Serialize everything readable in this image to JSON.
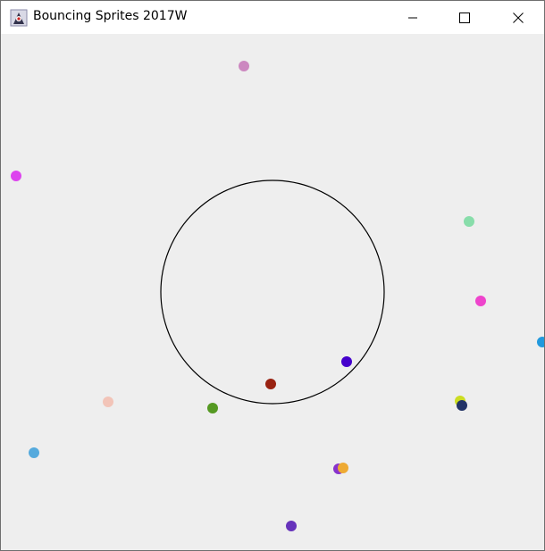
{
  "window": {
    "title": "Bouncing Sprites 2017W",
    "app_icon": "java-duke-icon",
    "controls": {
      "minimize_icon": "minimize-icon",
      "maximize_icon": "maximize-icon",
      "close_icon": "close-icon"
    }
  },
  "canvas": {
    "background": "#eeeeee",
    "boundary_circle": {
      "stroke": "#000000"
    },
    "sprites": [
      {
        "color": "#cc88c0"
      },
      {
        "color": "#dd44ee"
      },
      {
        "color": "#88ddaa"
      },
      {
        "color": "#ee44cc"
      },
      {
        "color": "#2299dd"
      },
      {
        "color": "#4400cc"
      },
      {
        "color": "#992211"
      },
      {
        "color": "#559922"
      },
      {
        "color": "#f2c4b8"
      },
      {
        "color": "#ccdd22"
      },
      {
        "color": "#223366"
      },
      {
        "color": "#55aadd"
      },
      {
        "color": "#8833cc"
      },
      {
        "color": "#eeaa33"
      },
      {
        "color": "#6633bb"
      }
    ]
  }
}
